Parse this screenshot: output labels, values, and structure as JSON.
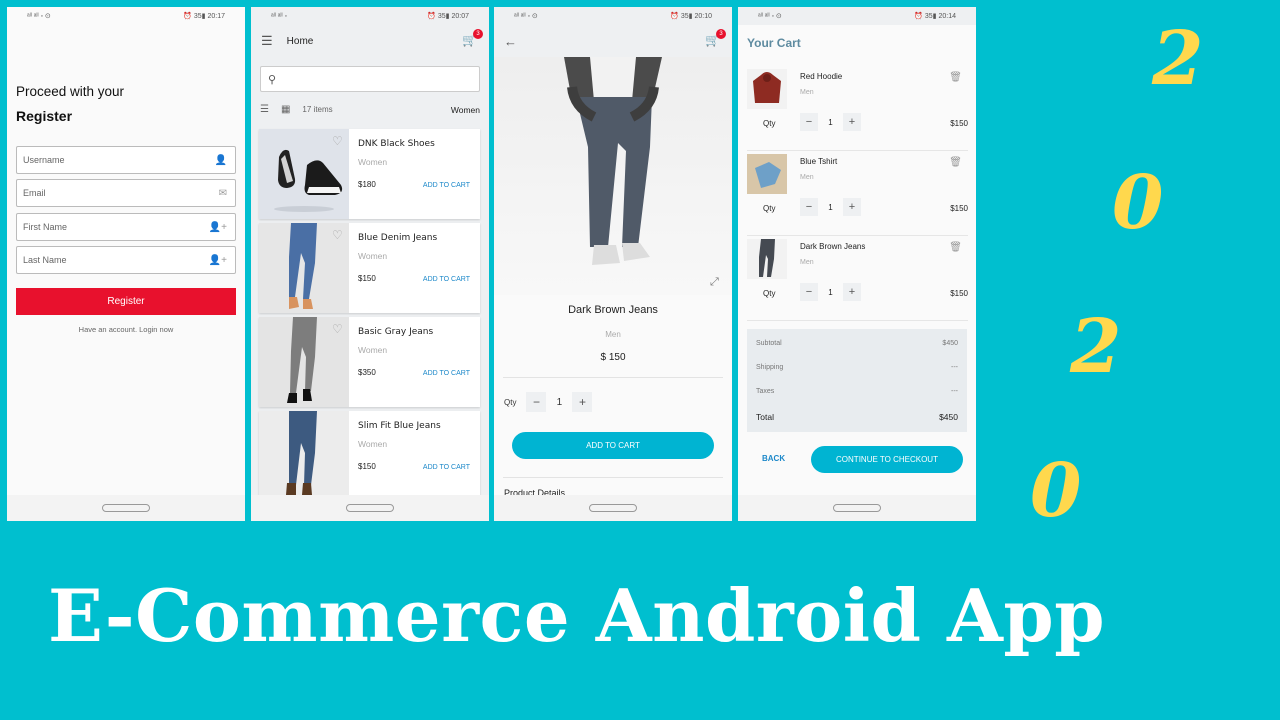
{
  "status": {
    "p1_time": "20:17",
    "p2_time": "20:07",
    "p3_time": "20:10",
    "p4_time": "20:14",
    "battery": "35"
  },
  "register": {
    "proceed": "Proceed with your",
    "title": "Register",
    "fields": [
      {
        "placeholder": "Username",
        "icon": "person-icon"
      },
      {
        "placeholder": "Email",
        "icon": "mail-icon"
      },
      {
        "placeholder": "First Name",
        "icon": "person-add-icon"
      },
      {
        "placeholder": "Last Name",
        "icon": "person-add-icon"
      }
    ],
    "button": "Register",
    "login_text": "Have an account. Login now"
  },
  "home": {
    "title": "Home",
    "cart_count": "3",
    "items_count": "17 items",
    "category": "Women",
    "products": [
      {
        "name": "DNK Black Shoes",
        "category": "Women",
        "price": "$180",
        "action": "ADD TO CART"
      },
      {
        "name": "Blue Denim Jeans",
        "category": "Women",
        "price": "$150",
        "action": "ADD TO CART"
      },
      {
        "name": "Basic Gray Jeans",
        "category": "Women",
        "price": "$350",
        "action": "ADD TO CART"
      },
      {
        "name": "Slim Fit Blue Jeans",
        "category": "Women",
        "price": "$150",
        "action": "ADD TO CART"
      }
    ]
  },
  "detail": {
    "cart_count": "3",
    "name": "Dark Brown Jeans",
    "category": "Men",
    "price": "$ 150",
    "qty_label": "Qty",
    "qty": "1",
    "button": "ADD TO CART",
    "details_heading": "Product Details"
  },
  "cart": {
    "title": "Your Cart",
    "items": [
      {
        "name": "Red Hoodie",
        "category": "Men",
        "qty_label": "Qty",
        "qty": "1",
        "price": "$150"
      },
      {
        "name": "Blue Tshirt",
        "category": "Men",
        "qty_label": "Qty",
        "qty": "1",
        "price": "$150"
      },
      {
        "name": "Dark Brown Jeans",
        "category": "Men",
        "qty_label": "Qty",
        "qty": "1",
        "price": "$150"
      }
    ],
    "summary": {
      "subtotal_label": "Subtotal",
      "subtotal": "$450",
      "shipping_label": "Shipping",
      "shipping": "---",
      "taxes_label": "Taxes",
      "taxes": "---",
      "total_label": "Total",
      "total": "$450"
    },
    "back": "BACK",
    "checkout": "CONTINUE TO CHECKOUT"
  },
  "year_digits": [
    "2",
    "0",
    "2",
    "0"
  ],
  "headline": "E-Commerce Android App",
  "colors": {
    "background": "#00bfcf",
    "year": "#ffd84d",
    "register_button": "#e8112d",
    "accent_button": "#00b4d2"
  }
}
